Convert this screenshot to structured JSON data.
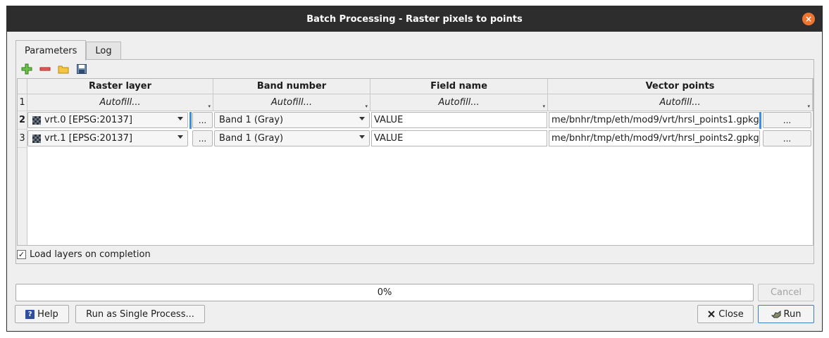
{
  "window": {
    "title": "Batch Processing - Raster pixels to points",
    "close_glyph": "×"
  },
  "tabs": [
    {
      "label": "Parameters"
    },
    {
      "label": "Log"
    }
  ],
  "toolbar": {
    "icons": [
      "add-row-icon",
      "remove-row-icon",
      "open-folder-icon",
      "save-icon"
    ]
  },
  "table": {
    "headers": [
      "Raster layer",
      "Band number",
      "Field name",
      "Vector points"
    ],
    "autofill_row": {
      "number": "1",
      "label": "Autofill...",
      "arrow": "▾"
    },
    "rows": [
      {
        "number": "2",
        "raster": "vrt.0 [EPSG:20137]",
        "browse": "...",
        "band": "Band 1 (Gray)",
        "field": "VALUE",
        "output": "me/bnhr/tmp/eth/mod9/vrt/hrsl_points1.gpkg",
        "output_browse": "..."
      },
      {
        "number": "3",
        "raster": "vrt.1 [EPSG:20137]",
        "browse": "...",
        "band": "Band 1 (Gray)",
        "field": "VALUE",
        "output": "me/bnhr/tmp/eth/mod9/vrt/hrsl_points2.gpkg",
        "output_browse": "..."
      }
    ]
  },
  "load_layers": {
    "label": "Load layers on completion",
    "checked": true,
    "glyph": "✓"
  },
  "progress": {
    "value": 0,
    "text": "0%"
  },
  "buttons": {
    "cancel": "Cancel",
    "help": "Help",
    "help_glyph": "?",
    "single": "Run as Single Process...",
    "close": "Close",
    "run": "Run"
  },
  "colors": {
    "accent": "#3d8ee0",
    "titlebar": "#2d2d2d",
    "close": "#f0742e"
  }
}
